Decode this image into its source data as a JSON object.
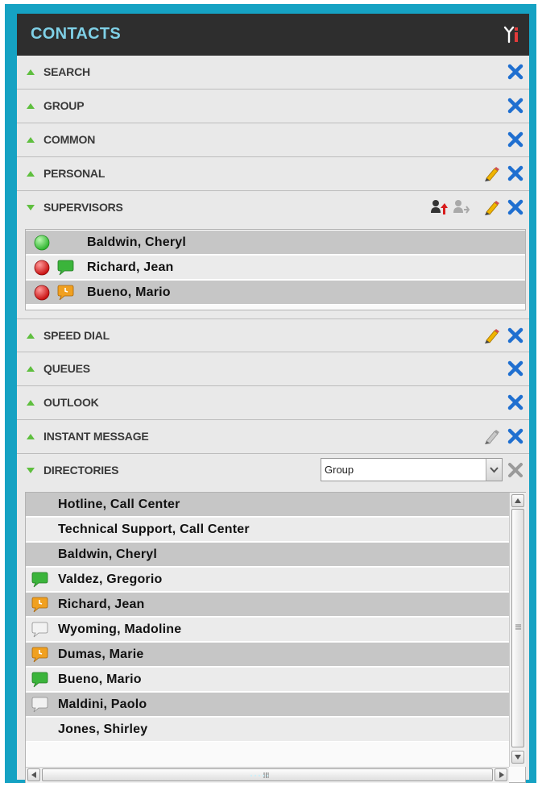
{
  "panel": {
    "title": "CONTACTS",
    "tools_icon": "tools-icon"
  },
  "sections": {
    "search": "SEARCH",
    "group": "GROUP",
    "common": "COMMON",
    "personal": "PERSONAL",
    "supervisors": "SUPERVISORS",
    "speed_dial": "SPEED DIAL",
    "queues": "QUEUES",
    "outlook": "OUTLOOK",
    "instant_message": "INSTANT MESSAGE",
    "directories": "DIRECTORIES"
  },
  "supervisors": [
    {
      "name": "Baldwin, Cheryl",
      "presence": "available",
      "chat": "none"
    },
    {
      "name": "Richard, Jean",
      "presence": "busy",
      "chat": "available"
    },
    {
      "name": "Bueno, Mario",
      "presence": "busy",
      "chat": "away"
    }
  ],
  "directories": {
    "select_value": "Group",
    "entries": [
      {
        "name": "Hotline, Call Center",
        "chat": "none"
      },
      {
        "name": "Technical Support, Call Center",
        "chat": "none"
      },
      {
        "name": "Baldwin, Cheryl",
        "chat": "none"
      },
      {
        "name": "Valdez, Gregorio",
        "chat": "available"
      },
      {
        "name": "Richard, Jean",
        "chat": "away"
      },
      {
        "name": "Wyoming, Madoline",
        "chat": "offline"
      },
      {
        "name": "Dumas, Marie",
        "chat": "away"
      },
      {
        "name": "Bueno, Mario",
        "chat": "available"
      },
      {
        "name": "Maldini, Paolo",
        "chat": "offline"
      },
      {
        "name": "Jones, Shirley",
        "chat": "none"
      }
    ]
  },
  "colors": {
    "frame": "#15a2c3",
    "titlebar": "#2e2e2e",
    "title_text": "#7fd0e6",
    "expand_triangle": "#5fbf3f",
    "close_x": "#1f6fd0",
    "presence_available": "#3fc83f",
    "presence_busy": "#d81c1c",
    "chat_available": "#3bb43b",
    "chat_away": "#f0a020",
    "chat_offline": "#e6e6e6"
  }
}
